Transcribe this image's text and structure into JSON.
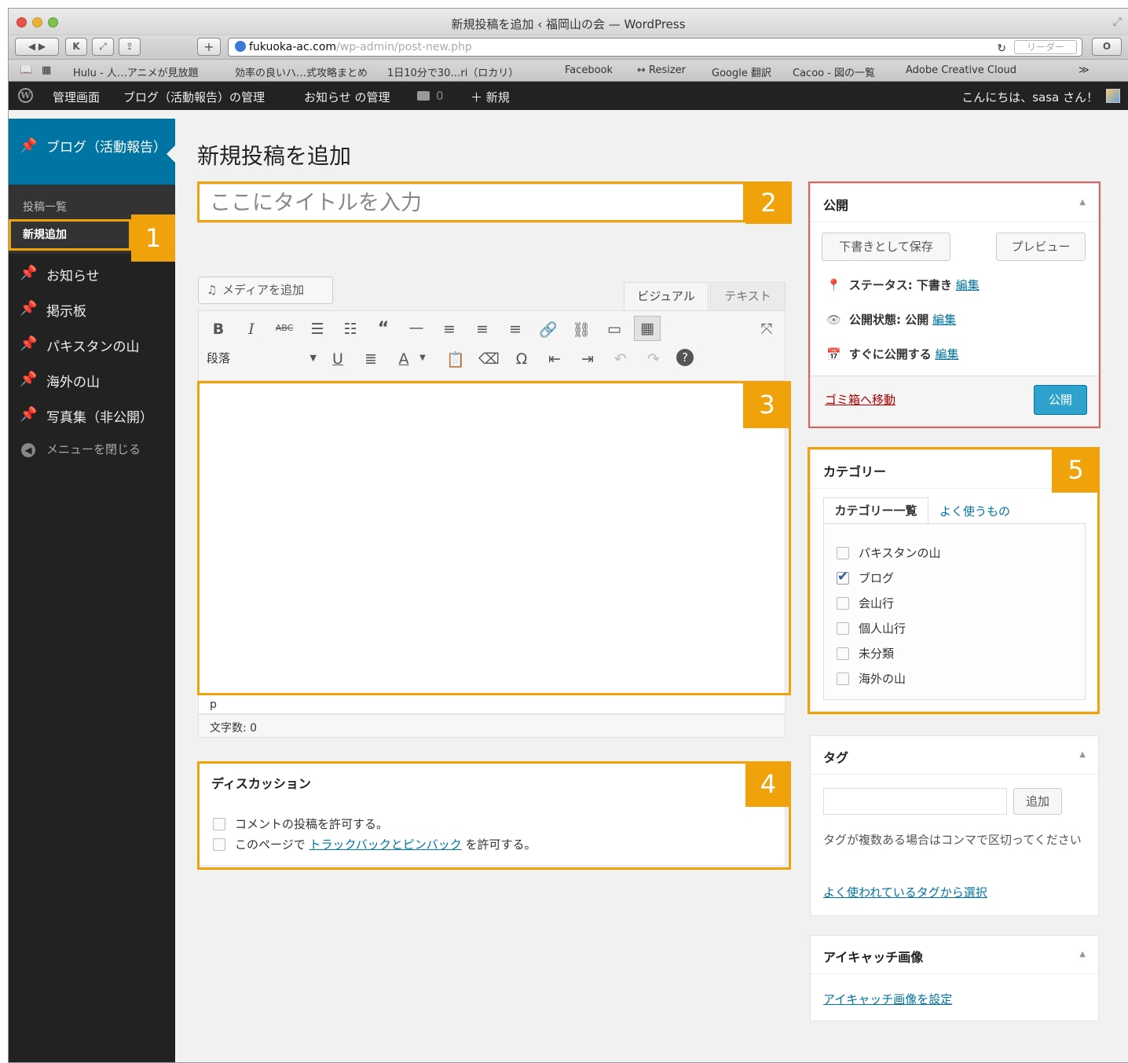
{
  "browser": {
    "window_title": "新規投稿を追加 ‹ 福岡山の会 — WordPress",
    "url_host": "fukuoka-ac.com",
    "url_path": "/wp-admin/post-new.php",
    "reader_label": "リーダー",
    "bookmarks": [
      "Hulu - 人…アニメが見放題",
      "効率の良いハ…式攻略まとめ",
      "1日10分で30…ri（ロカリ）",
      "Facebook",
      "↔ Resizer",
      "Google 翻訳",
      "Cacoo - 図の一覧",
      "Adobe Creative Cloud",
      "≫"
    ]
  },
  "adminbar": {
    "dashboard": "管理画面",
    "manage_blog": "ブログ（活動報告）の管理",
    "manage_news": "お知らせ の管理",
    "comments_count": "0",
    "new_label": "＋ 新規",
    "greeting": "こんにちは、sasa さん！"
  },
  "sidebar": {
    "current_menu": "ブログ（活動報告）",
    "submenu": [
      "投稿一覧",
      "新規追加"
    ],
    "items": [
      "お知らせ",
      "掲示板",
      "パキスタンの山",
      "海外の山",
      "写真集（非公開）"
    ],
    "collapse": "メニューを閉じる"
  },
  "editor": {
    "page_title": "新規投稿を追加",
    "title_placeholder": "ここにタイトルを入力",
    "add_media": "メディアを追加",
    "tab_visual": "ビジュアル",
    "tab_text": "テキスト",
    "format_select": "段落",
    "path": "p",
    "word_count": "文字数: 0"
  },
  "discussion": {
    "title": "ディスカッション",
    "allow_comments": "コメントの投稿を許可する。",
    "allow_pings_prefix": "このページで ",
    "allow_pings_link": "トラックバックとピンバック",
    "allow_pings_suffix": " を許可する。"
  },
  "publish": {
    "title": "公開",
    "save_draft": "下書きとして保存",
    "preview": "プレビュー",
    "status": "ステータス: 下書き",
    "visibility": "公開状態: 公開",
    "schedule": "すぐに公開する",
    "edit": "編集",
    "trash": "ゴミ箱へ移動",
    "publish_button": "公開"
  },
  "categories": {
    "title": "カテゴリー",
    "tab_all": "カテゴリー一覧",
    "tab_popular": "よく使うもの",
    "items": [
      {
        "label": "パキスタンの山",
        "checked": false
      },
      {
        "label": "ブログ",
        "checked": true
      },
      {
        "label": "会山行",
        "checked": false
      },
      {
        "label": "個人山行",
        "checked": false
      },
      {
        "label": "未分類",
        "checked": false
      },
      {
        "label": "海外の山",
        "checked": false
      }
    ]
  },
  "tags": {
    "title": "タグ",
    "add_button": "追加",
    "hint": "タグが複数ある場合はコンマで区切ってください",
    "choose_link": "よく使われているタグから選択"
  },
  "featured_image": {
    "title": "アイキャッチ画像",
    "set_link": "アイキャッチ画像を設定"
  },
  "annotations": [
    "1",
    "2",
    "3",
    "4",
    "5"
  ],
  "colors": {
    "annotation": "#f0a20a",
    "wp_blue": "#0074a2",
    "admin_dark": "#222222",
    "trash_red": "#a00"
  }
}
